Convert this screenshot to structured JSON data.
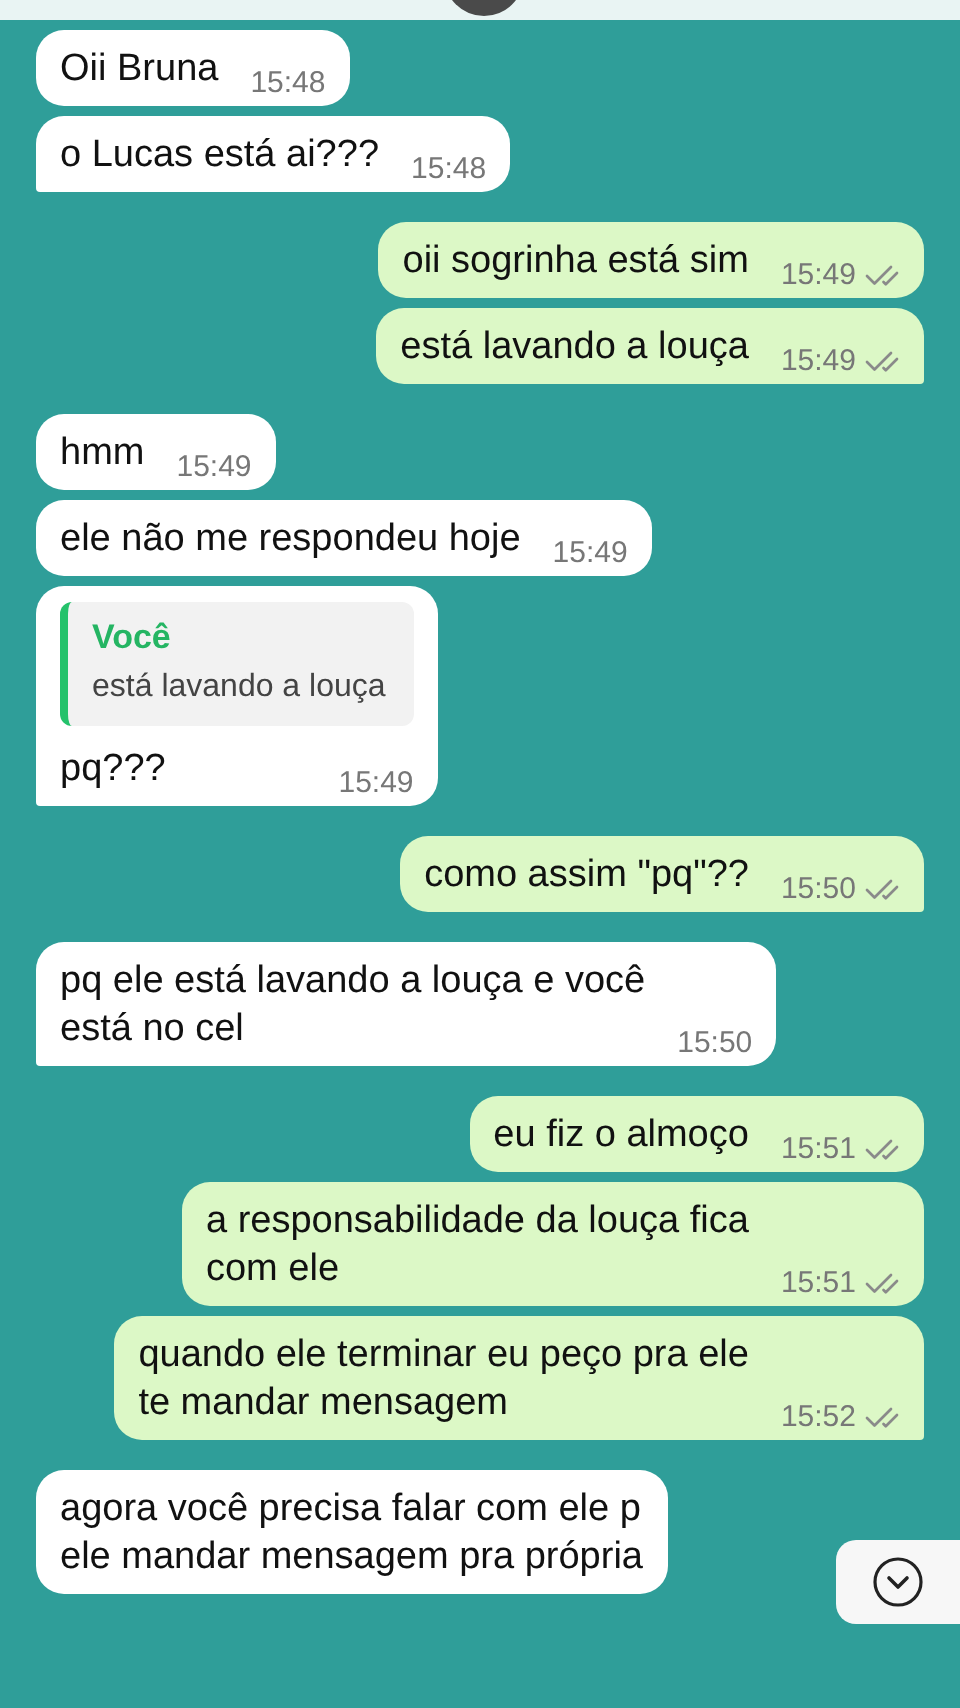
{
  "messages": [
    {
      "kind": "incoming",
      "text": "Oii Bruna",
      "time": "15:48",
      "tail": false
    },
    {
      "kind": "incoming",
      "text": "o Lucas está ai???",
      "time": "15:48",
      "tail": true
    },
    {
      "kind": "outgoing",
      "text": "oii sogrinha está sim",
      "time": "15:49",
      "read": false,
      "tail": false
    },
    {
      "kind": "outgoing",
      "text": "está lavando a louça",
      "time": "15:49",
      "read": false,
      "tail": true
    },
    {
      "kind": "incoming",
      "text": "hmm",
      "time": "15:49",
      "tail": false
    },
    {
      "kind": "incoming",
      "text": "ele não me respondeu hoje",
      "time": "15:49",
      "tail": false
    },
    {
      "kind": "incoming",
      "quote": {
        "author": "Você",
        "text": "está lavando a louça"
      },
      "text": "pq???",
      "time": "15:49",
      "tail": true
    },
    {
      "kind": "outgoing",
      "text": "como assim \"pq\"??",
      "time": "15:50",
      "read": false,
      "tail": true
    },
    {
      "kind": "incoming",
      "text": "pq ele está lavando a louça e você\nestá no cel",
      "time": "15:50",
      "tail": true
    },
    {
      "kind": "outgoing",
      "text": "eu fiz o almoço",
      "time": "15:51",
      "read": false,
      "tail": false
    },
    {
      "kind": "outgoing",
      "text": "a responsabilidade da louça fica\ncom ele",
      "time": "15:51",
      "read": false,
      "tail": false
    },
    {
      "kind": "outgoing",
      "text": "quando ele terminar eu peço pra ele\nte mandar mensagem",
      "time": "15:52",
      "read": false,
      "tail": true
    },
    {
      "kind": "incoming",
      "text": "agora você precisa falar com ele p\nele mandar mensagem pra própria"
    }
  ]
}
